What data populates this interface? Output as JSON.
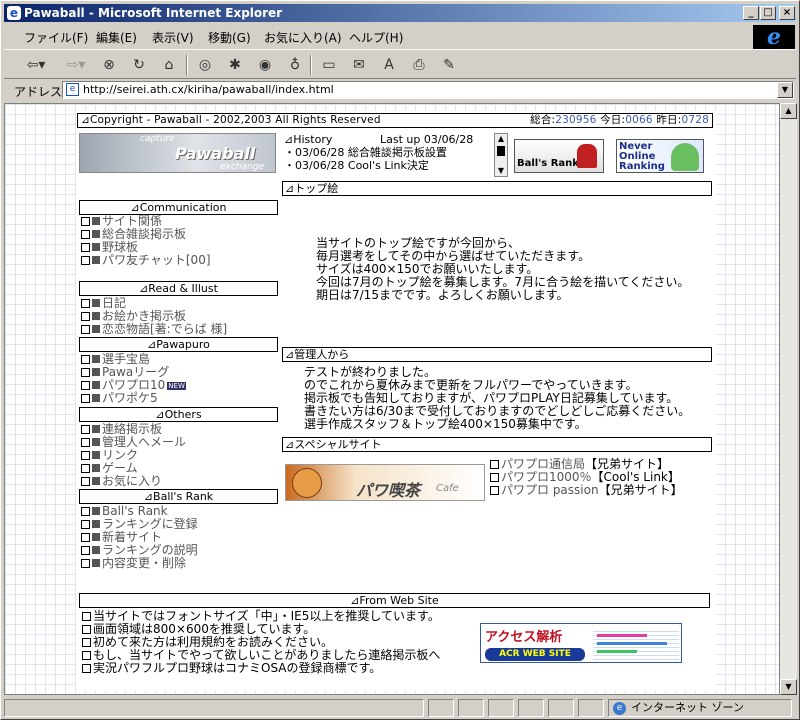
{
  "window": {
    "title": "Pawaball - Microsoft Internet Explorer"
  },
  "menu": [
    "ファイル(F)",
    "編集(E)",
    "表示(V)",
    "移動(G)",
    "お気に入り(A)",
    "ヘルプ(H)"
  ],
  "address": {
    "label": "アドレス",
    "url": "http://seirei.ath.cx/kiriha/pawaball/index.html"
  },
  "header": {
    "copyright": "⊿Copyright - Pawaball - 2002,2003  All Rights Reserved",
    "total_label": "総合:",
    "total": "230956",
    "today_label": "今日:",
    "today": "0066",
    "yesterday_label": "昨日:",
    "yesterday": "0728"
  },
  "logo": {
    "text": "Pawaball",
    "small_top": "capture",
    "small_bottom": "exchange"
  },
  "history": {
    "title": "⊿History",
    "lastup": "Last up 03/06/28",
    "lines": [
      "・03/06/28  総合雑談掲示板設置",
      "・03/06/28  Cool's Link決定"
    ]
  },
  "banners": {
    "balls_rank": "Ball's Rank",
    "never_online": "Never Online Ranking"
  },
  "sidebar": {
    "communication": {
      "title": "⊿Communication",
      "items": [
        "サイト関係",
        "総合雑談掲示板",
        "野球板",
        "パワ友チャット[00]"
      ]
    },
    "read_illust": {
      "title": "⊿Read & Illust",
      "items": [
        "日記",
        "お絵かき掲示板",
        "恋恋物語[著:でらば 様]"
      ]
    },
    "pawapuro": {
      "title": "⊿Pawapuro",
      "items": [
        "選手宝島",
        "Pawaリーグ",
        "パワプロ10",
        "パワポケ5"
      ],
      "new_badge": "NEW"
    },
    "others": {
      "title": "⊿Others",
      "items": [
        "連絡掲示板",
        "管理人へメール",
        "リンク",
        "ゲーム",
        "お気に入り"
      ]
    },
    "balls_rank": {
      "title": "⊿Ball's Rank",
      "items": [
        "Ball's Rank",
        "ランキングに登録",
        "新着サイト",
        "ランキングの説明",
        "内容変更・削除"
      ]
    }
  },
  "top_picture": {
    "title": "⊿トップ絵",
    "lines": [
      "当サイトのトップ絵ですが今回から、",
      "毎月選考をしてその中から選ばせていただきます。",
      "サイズは400×150でお願いいたします。",
      "今回は7月のトップ絵を募集します。7月に合う絵を描いてください。",
      "期日は7/15までです。よろしくお願いします。"
    ]
  },
  "admin": {
    "title": "⊿管理人から",
    "lines": [
      "テストが終わりました。",
      "のでこれから夏休みまで更新をフルパワーでやっていきます。",
      "掲示板でも告知しておりますが、パワプロPLAY日記募集しています。",
      "書きたい方は6/30まで受付しておりますのでどしどしご応募ください。",
      "選手作成スタッフ＆トップ絵400×150募集中です。"
    ]
  },
  "special": {
    "title": "⊿スペシャルサイト",
    "banner_text": "パワ喫茶",
    "banner_sub": "Cafe",
    "links": [
      {
        "name": "パワプロ通信局",
        "tag": "【兄弟サイト】"
      },
      {
        "name": "パワプロ1000％",
        "tag": "【Cool's Link】"
      },
      {
        "name": "パワプロ passion",
        "tag": "【兄弟サイト】"
      }
    ]
  },
  "footer": {
    "title": "⊿From Web Site",
    "lines": [
      "当サイトではフォントサイズ「中」・IE5以上を推奨しています。",
      "画面領域は800×600を推奨しています。",
      "初めて来た方は利用規約をお読みください。",
      "もし、当サイトでやって欲しいことがありましたら連絡掲示板へ",
      "実況パワフルプロ野球はコナミOSAの登録商標です。"
    ],
    "acr_title": "アクセス解析",
    "acr_sub": "ACR WEB SITE"
  },
  "status": {
    "zone": "インターネット ゾーン"
  }
}
